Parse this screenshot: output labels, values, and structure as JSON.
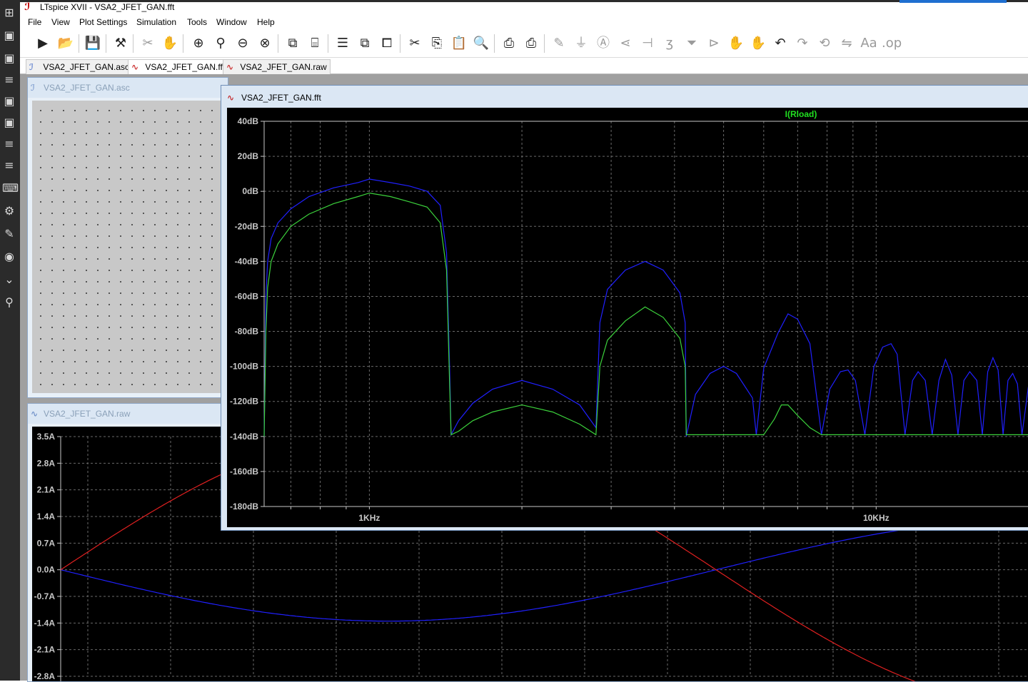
{
  "window": {
    "title": "LTspice XVII - VSA2_JFET_GAN.fft"
  },
  "menu": [
    "File",
    "View",
    "Plot Settings",
    "Simulation",
    "Tools",
    "Window",
    "Help"
  ],
  "menu_accel": [
    "F",
    "V",
    "P",
    "S",
    "T",
    "W",
    "H"
  ],
  "toolbar": [
    "run-icon",
    "open-icon",
    "save-icon",
    "control-panel-icon",
    "cut-wire-icon",
    "pan-icon",
    "zoom-in-icon",
    "zoom-fit-icon",
    "zoom-out-icon",
    "zoom-cancel-icon",
    "autorange-icon",
    "mark-unused-icon",
    "tile-horizontal-icon",
    "cascade-icon",
    "tile-vertical-icon",
    "cut-icon",
    "copy-icon",
    "paste-icon",
    "find-icon",
    "print-preview-icon",
    "print-icon",
    "wire-icon",
    "ground-icon",
    "label-icon",
    "resistor-icon",
    "capacitor-icon",
    "inductor-icon",
    "diode-icon",
    "component-icon",
    "move-icon",
    "drag-icon",
    "undo-icon",
    "redo-icon",
    "rotate-icon",
    "mirror-icon",
    "text-icon",
    "spice-directive-icon"
  ],
  "tabs": [
    {
      "label": "VSA2_JFET_GAN.asc",
      "active": false,
      "icon": "schematic-icon"
    },
    {
      "label": "VSA2_JFET_GAN.fft",
      "active": true,
      "icon": "waveform-icon"
    },
    {
      "label": "VSA2_JFET_GAN.raw",
      "active": false,
      "icon": "waveform-icon"
    }
  ],
  "schematic_window": {
    "title": "VSA2_JFET_GAN.asc"
  },
  "raw_window": {
    "title": "VSA2_JFET_GAN.raw"
  },
  "fft_window": {
    "title": "VSA2_JFET_GAN.fft"
  },
  "colors": {
    "background": "#000000",
    "grid": "#6a6a6a",
    "trace_blue": "#2020ff",
    "trace_green": "#3cd23c",
    "trace_red": "#e02020",
    "axis_text": "#c8c8c8",
    "legend_green": "#20e020"
  },
  "chart_data": [
    {
      "type": "line",
      "title": "",
      "legend": [
        "I(Rload)"
      ],
      "xscale": "log",
      "xlim": [
        620,
        20000
      ],
      "ylim": [
        -180,
        40
      ],
      "y_ticks": [
        "40dB",
        "20dB",
        "0dB",
        "-20dB",
        "-40dB",
        "-60dB",
        "-80dB",
        "-100dB",
        "-120dB",
        "-140dB",
        "-160dB",
        "-180dB"
      ],
      "x_tick_labels": [
        {
          "value": 1000,
          "label": "1KHz"
        },
        {
          "value": 10000,
          "label": "10KHz"
        }
      ],
      "series": [
        {
          "name": "I(Rload)",
          "color": "blue",
          "points": [
            [
              620,
              -140
            ],
            [
              625,
              -60
            ],
            [
              630,
              -40
            ],
            [
              640,
              -27
            ],
            [
              660,
              -18
            ],
            [
              700,
              -10
            ],
            [
              760,
              -3
            ],
            [
              850,
              2
            ],
            [
              950,
              5
            ],
            [
              1000,
              7
            ],
            [
              1100,
              5
            ],
            [
              1200,
              3
            ],
            [
              1300,
              0
            ],
            [
              1380,
              -8
            ],
            [
              1420,
              -35
            ],
            [
              1440,
              -100
            ],
            [
              1450,
              -139
            ],
            [
              1500,
              -131
            ],
            [
              1600,
              -121
            ],
            [
              1750,
              -113
            ],
            [
              2000,
              -108
            ],
            [
              2300,
              -113
            ],
            [
              2600,
              -122
            ],
            [
              2800,
              -135
            ],
            [
              2850,
              -75
            ],
            [
              2950,
              -56
            ],
            [
              3200,
              -45
            ],
            [
              3500,
              -40
            ],
            [
              3800,
              -45
            ],
            [
              4100,
              -58
            ],
            [
              4200,
              -75
            ],
            [
              4220,
              -140
            ],
            [
              4400,
              -116
            ],
            [
              4700,
              -104
            ],
            [
              5000,
              -100
            ],
            [
              5300,
              -104
            ],
            [
              5700,
              -118
            ],
            [
              5800,
              -139
            ],
            [
              6000,
              -101
            ],
            [
              6400,
              -81
            ],
            [
              6700,
              -70
            ],
            [
              7000,
              -73
            ],
            [
              7400,
              -87
            ],
            [
              7800,
              -139
            ],
            [
              8100,
              -113
            ],
            [
              8500,
              -103
            ],
            [
              8800,
              -102
            ],
            [
              9100,
              -108
            ],
            [
              9500,
              -139
            ],
            [
              9900,
              -100
            ],
            [
              10300,
              -89
            ],
            [
              10700,
              -87
            ],
            [
              11000,
              -93
            ],
            [
              11400,
              -139
            ],
            [
              11800,
              -108
            ],
            [
              12100,
              -103
            ],
            [
              12500,
              -108
            ],
            [
              12900,
              -139
            ],
            [
              13300,
              -108
            ],
            [
              13700,
              -96
            ],
            [
              14100,
              -105
            ],
            [
              14500,
              -139
            ],
            [
              14900,
              -108
            ],
            [
              15300,
              -103
            ],
            [
              15800,
              -108
            ],
            [
              16200,
              -139
            ],
            [
              16600,
              -103
            ],
            [
              17000,
              -95
            ],
            [
              17400,
              -102
            ],
            [
              17800,
              -139
            ],
            [
              18200,
              -108
            ],
            [
              18600,
              -104
            ],
            [
              19000,
              -110
            ],
            [
              19400,
              -139
            ],
            [
              20000,
              -110
            ]
          ]
        },
        {
          "name": "",
          "color": "green",
          "points": [
            [
              620,
              -140
            ],
            [
              625,
              -80
            ],
            [
              630,
              -55
            ],
            [
              640,
              -40
            ],
            [
              660,
              -30
            ],
            [
              700,
              -20
            ],
            [
              760,
              -13
            ],
            [
              850,
              -7
            ],
            [
              950,
              -3
            ],
            [
              1000,
              -1
            ],
            [
              1100,
              -3
            ],
            [
              1200,
              -6
            ],
            [
              1300,
              -9
            ],
            [
              1380,
              -18
            ],
            [
              1420,
              -45
            ],
            [
              1440,
              -110
            ],
            [
              1450,
              -139
            ],
            [
              1500,
              -137
            ],
            [
              1600,
              -131
            ],
            [
              1750,
              -126
            ],
            [
              2000,
              -122
            ],
            [
              2300,
              -126
            ],
            [
              2600,
              -133
            ],
            [
              2800,
              -139
            ],
            [
              2850,
              -100
            ],
            [
              2950,
              -85
            ],
            [
              3200,
              -74
            ],
            [
              3500,
              -66
            ],
            [
              3800,
              -72
            ],
            [
              4100,
              -84
            ],
            [
              4200,
              -100
            ],
            [
              4220,
              -139
            ],
            [
              5800,
              -139
            ],
            [
              6000,
              -139
            ],
            [
              6300,
              -130
            ],
            [
              6500,
              -122
            ],
            [
              6700,
              -122
            ],
            [
              7000,
              -128
            ],
            [
              7400,
              -135
            ],
            [
              7800,
              -139
            ],
            [
              9000,
              -139
            ],
            [
              12000,
              -139
            ],
            [
              16000,
              -139
            ],
            [
              20000,
              -139
            ]
          ]
        }
      ]
    },
    {
      "type": "line",
      "title": "",
      "ylim": [
        -2.8,
        3.5
      ],
      "y_ticks": [
        "3.5A",
        "2.8A",
        "2.1A",
        "1.4A",
        "0.7A",
        "0.0A",
        "-0.7A",
        "-1.4A",
        "-2.1A",
        "-2.8A"
      ],
      "series": [
        {
          "name": "",
          "color": "blue",
          "shape": "sine",
          "amplitude": 1.35,
          "period_start": 0.0,
          "period_end": 2.0
        },
        {
          "name": "",
          "color": "red",
          "shape": "sine",
          "amplitude": 3.6,
          "period_start": 0.0,
          "period_end": 2.0
        }
      ]
    }
  ]
}
